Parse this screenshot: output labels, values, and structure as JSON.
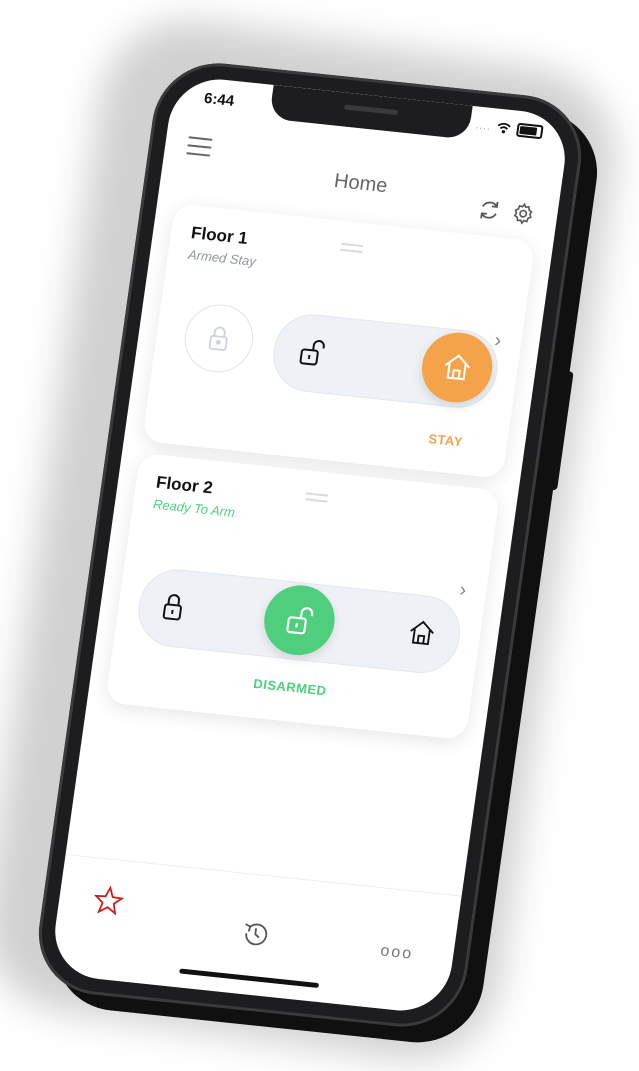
{
  "status_bar": {
    "time": "6:44",
    "signal": "...."
  },
  "header": {
    "title": "Home"
  },
  "partitions": [
    {
      "name": "Floor 1",
      "status": "Armed Stay",
      "status_color": "#8b97a6",
      "mode_label": "STAY",
      "mode_color": "#f5a34b"
    },
    {
      "name": "Floor 2",
      "status": "Ready To Arm",
      "status_color": "#4fcf7e",
      "mode_label": "DISARMED",
      "mode_color": "#4fcf7e"
    }
  ],
  "tabbar": {
    "tabs": [
      {
        "icon": "star-icon",
        "active": true,
        "color": "#c81e1e"
      },
      {
        "icon": "history-icon",
        "active": false
      },
      {
        "icon": "more-icon",
        "label": "ooo",
        "active": false
      }
    ]
  },
  "colors": {
    "stay": "#f5a34b",
    "disarmed": "#4fcf7e",
    "accent_red": "#c81e1e"
  }
}
